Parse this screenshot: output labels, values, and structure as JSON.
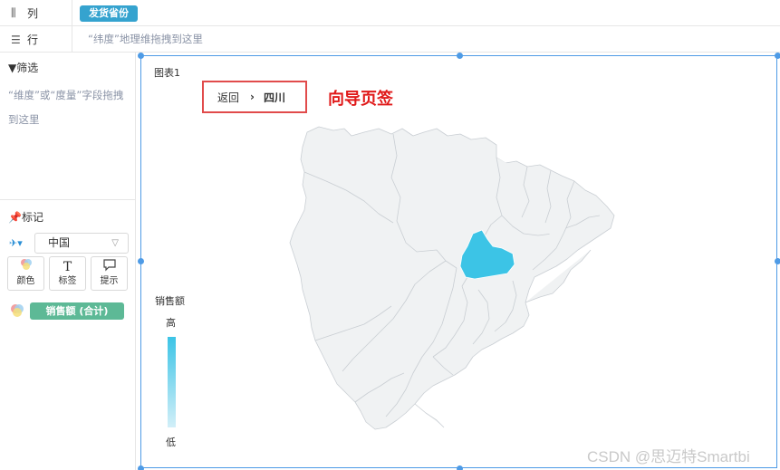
{
  "shelves": {
    "columns": {
      "label": "列",
      "icon": "columns-icon",
      "pill": "发货省份"
    },
    "rows": {
      "label": "行",
      "icon": "list-icon",
      "hint": "“纬度”地理维拖拽到这里"
    }
  },
  "filter": {
    "title": "筛选",
    "hint": "“维度”或“度量”字段拖拽到这里"
  },
  "marks": {
    "title": "标记",
    "map_select": "中国",
    "buttons": [
      {
        "label": "颜色",
        "icon": "color-icon"
      },
      {
        "label": "标签",
        "icon": "text-icon"
      },
      {
        "label": "提示",
        "icon": "tooltip-icon"
      }
    ],
    "measure_pill": "销售额 (合计)"
  },
  "chart": {
    "title": "图表1",
    "breadcrumb": {
      "back": "返回",
      "current": "四川"
    },
    "annotation": "向导页签",
    "legend": {
      "title": "销售额",
      "high": "高",
      "low": "低"
    },
    "colors": {
      "highlight": "#3cc4e6",
      "region": "#f0f2f3",
      "border": "#c9ced3",
      "frame": "#4e9be6",
      "annotation": "#e01919"
    }
  },
  "watermark": "CSDN @思迈特Smartbi"
}
